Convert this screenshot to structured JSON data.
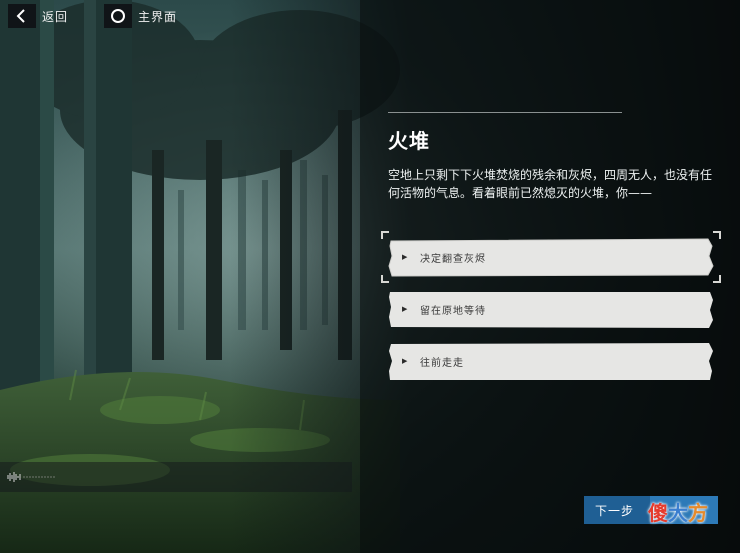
{
  "nav": {
    "back_label": "返回",
    "home_label": "主界面",
    "back_icon": "chevron-left-icon",
    "home_icon": "circle-icon"
  },
  "story": {
    "title": "火堆",
    "description": "空地上只剩下下火堆焚烧的残余和灰烬，四周无人，也没有任何活物的气息。看着眼前已然熄灭的火堆，你——"
  },
  "choices": [
    {
      "label": "决定翻查灰烬",
      "selected": true
    },
    {
      "label": "留在原地等待",
      "selected": false
    },
    {
      "label": "往前走走",
      "selected": false
    }
  ],
  "footer": {
    "next_label": "下一步"
  },
  "watermark": {
    "c1": "傻",
    "c2": "大",
    "c3": "方"
  },
  "colors": {
    "primary_button": "#1f5f94",
    "choice_paper": "#e6e6e4",
    "panel_text": "#eef2f2"
  }
}
